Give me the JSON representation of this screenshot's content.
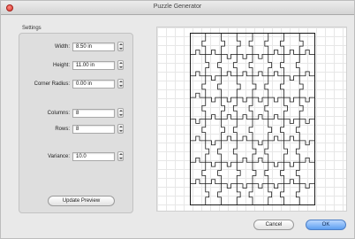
{
  "window": {
    "title": "Puzzle Generator"
  },
  "settings": {
    "group_title": "Settings",
    "width": {
      "label": "Width:",
      "value": "8.50 in"
    },
    "height": {
      "label": "Height:",
      "value": "11.00 in"
    },
    "corner_radius": {
      "label": "Corner Radius:",
      "value": "0.00 in"
    },
    "columns": {
      "label": "Columns:",
      "value": "8"
    },
    "rows": {
      "label": "Rows:",
      "value": "8"
    },
    "variance": {
      "label": "Variance:",
      "value": "10.0"
    },
    "update_button": "Update Preview"
  },
  "preview": {
    "columns": 8,
    "rows": 8
  },
  "footer": {
    "cancel": "Cancel",
    "ok": "OK"
  }
}
